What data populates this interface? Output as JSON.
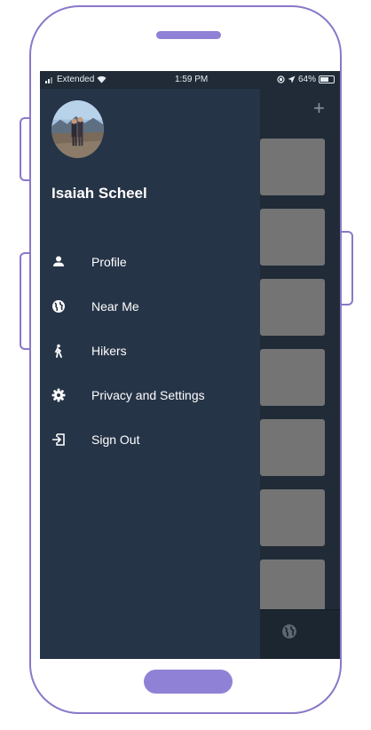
{
  "status_bar": {
    "carrier": "Extended",
    "time": "1:59 PM",
    "battery": "64%",
    "battery_level": 0.64
  },
  "drawer": {
    "user_name": "Isaiah Scheel",
    "menu": [
      {
        "label": "Profile",
        "icon": "person-icon"
      },
      {
        "label": "Near Me",
        "icon": "globe-icon"
      },
      {
        "label": "Hikers",
        "icon": "walking-icon"
      },
      {
        "label": "Privacy and Settings",
        "icon": "gear-icon"
      },
      {
        "label": "Sign Out",
        "icon": "sign-out-icon"
      }
    ]
  },
  "background_screen": {
    "add_button": "+",
    "card_count": 7,
    "tab_icon": "globe-icon"
  },
  "colors": {
    "drawer_bg": "#263447",
    "screen_bg": "#202b37",
    "card_bg": "#747474",
    "frame": "#8a78c9",
    "text": "#ffffff"
  }
}
